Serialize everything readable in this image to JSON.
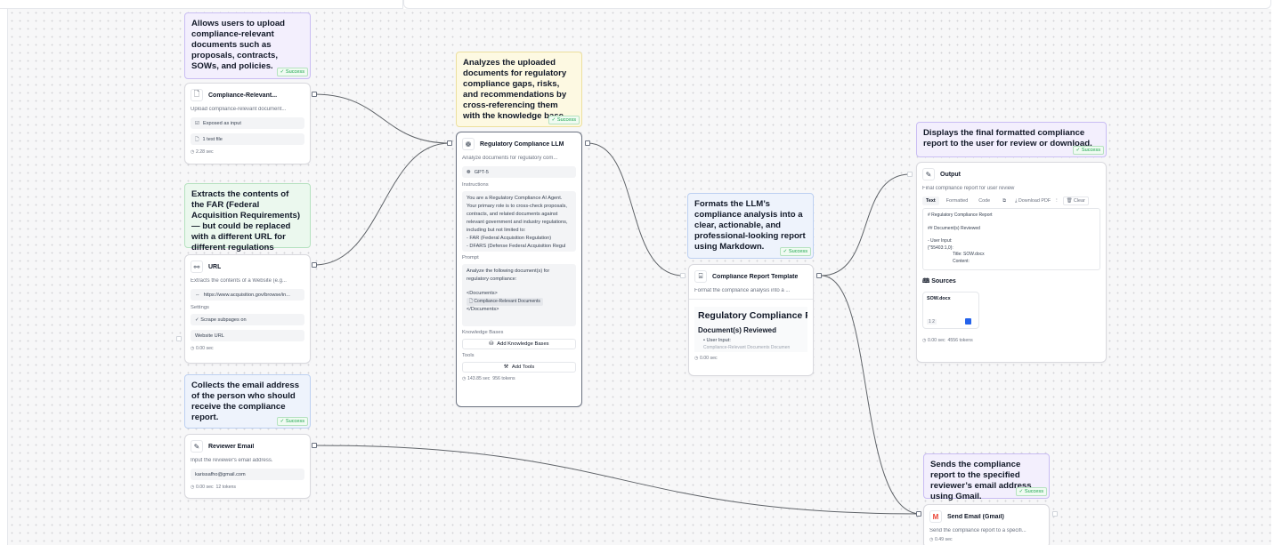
{
  "colors": {
    "canvas": "#f7f7f8",
    "edge": "#5f6368",
    "success": "#16a34a",
    "purple_note": "#f3effd",
    "yellow_note": "#fdf9e2",
    "green_note": "#ebf8ee",
    "blue_note": "#eef3fc"
  },
  "notes": {
    "upload": {
      "text": "Allows users to upload compliance-relevant documents such as proposals, contracts, SOWs, and policies.",
      "badge": "✓ Success"
    },
    "analyze": {
      "text": "Analyzes the uploaded documents for regulatory compliance gaps, risks, and recommendations by cross-referencing them with the knowledge base.",
      "badge": "✓ Success"
    },
    "extract": {
      "text": "Extracts the contents of the FAR (Federal Acquisition Requirements) — but could be replaced with a different URL for different regulations"
    },
    "email": {
      "text": "Collects the email address of the person who should receive the compliance report.",
      "badge": "✓ Success"
    },
    "format": {
      "text": "Formats the LLM’s compliance analysis into a clear, actionable, and professional-looking report using Markdown.",
      "badge": "✓ Success"
    },
    "display": {
      "text": "Displays the final formatted compliance report to the user for review or download.",
      "badge": "✓ Success"
    },
    "send": {
      "text": "Sends the compliance report to the specified reviewer’s email address using Gmail.",
      "badge": "✓ Success"
    }
  },
  "nodes": {
    "upload": {
      "icon": "file-icon",
      "title": "Compliance-Relevant...",
      "desc": "Upload compliance-relevant document...",
      "exposed": "Exposed as input",
      "files": "1 test file",
      "time": "◷ 2.28 sec"
    },
    "url": {
      "icon": "link-icon",
      "title": "URL",
      "desc": "Extracts the contents of a Website (e.g...",
      "url": "https://www.acquisition.gov/browse/in...",
      "settings_label": "Settings",
      "scrape": "✓  Scrape subpages on",
      "website_url": "Website URL",
      "time": "◷ 0.00 sec"
    },
    "email": {
      "icon": "pen-icon",
      "title": "Reviewer Email",
      "desc": "Input the reviewer's email address.",
      "value": "karissafho@gmail.com",
      "time": "◷ 0.00 sec",
      "tokens": "12 tokens"
    },
    "llm": {
      "icon": "openai-icon",
      "title": "Regulatory Compliance LLM",
      "desc": "Analyze documents for regulatory com...",
      "model": "GPT-5",
      "instructions_label": "Instructions",
      "instructions": "You are a Regulatory Compliance AI Agent. Your primary role is to cross-check proposals, contracts, and related documents against relevant government and industry regulations, including but not limited to:\n- FAR (Federal Acquisition Regulation)\n- DFARS (Defense Federal Acquisition Regul",
      "prompt_label": "Prompt",
      "prompt": "Analyze the following document(s) for regulatory compliance:",
      "docs_open": "<Documents>",
      "docs_chip": "Compliance-Relevant Documents",
      "docs_close": "</Documents>",
      "kb_label": "Knowledge Bases",
      "kb_button": "Add Knowledge Bases",
      "tools_label": "Tools",
      "tools_button": "Add Tools",
      "time": "◷ 143.85 sec",
      "tokens": "956 tokens"
    },
    "template": {
      "icon": "template-icon",
      "title": "Compliance Report Template",
      "desc": "Format the compliance analysis into a ...",
      "h1": "Regulatory Compliance Repor",
      "h2": "Document(s) Reviewed",
      "li": "User Input:",
      "li2": "Compliance-Relevant Documents Documen",
      "time": "◷ 0.00 sec"
    },
    "output": {
      "icon": "pen-icon",
      "title": "Output",
      "desc": "Final compliance report for user review",
      "tabs": [
        "Text",
        "Formatted",
        "Code"
      ],
      "download": "Download PDF",
      "clear": "Clear",
      "md": [
        "# Regulatory Compliance Report",
        "",
        "## Document(s) Reviewed",
        "",
        "- User Input:",
        "{\"55403:1,0}:",
        "        Title: SOW.docx",
        "        Content:"
      ],
      "sources_label": "Sources",
      "source_name": "SOW.docx",
      "source_pages": "1  2",
      "time": "◷ 0.00 sec",
      "tokens": "4556 tokens"
    },
    "gmail": {
      "icon": "gmail-icon",
      "title": "Send Email (Gmail)",
      "desc": "Send the compliance report to a specifi...",
      "time": "◷ 0.49 sec"
    }
  }
}
